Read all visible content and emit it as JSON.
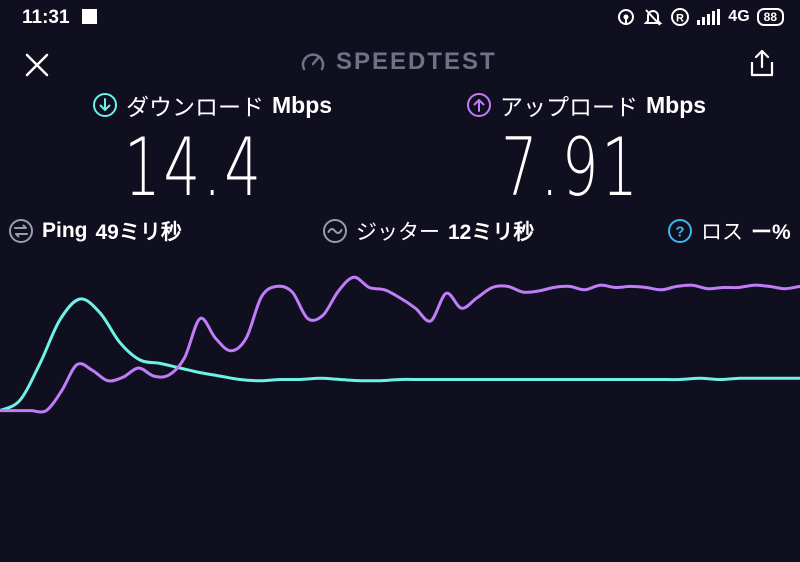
{
  "status_bar": {
    "time": "11:31",
    "network": "4G",
    "battery": "88",
    "icons": [
      "hotspot-icon",
      "notifications-muted-icon",
      "roaming-icon",
      "signal-icon"
    ]
  },
  "header": {
    "title": "SPEEDTEST",
    "close_icon": "close-icon",
    "share_icon": "share-icon"
  },
  "download": {
    "label": "ダウンロード",
    "unit": "Mbps",
    "value": "14.4",
    "color": "#6ff0e8"
  },
  "upload": {
    "label": "アップロード",
    "unit": "Mbps",
    "value": "7.91",
    "color": "#c17cf7"
  },
  "stats": {
    "ping_label": "Ping",
    "ping_value": "49ミリ秒",
    "jitter_label": "ジッター",
    "jitter_value": "12ミリ秒",
    "loss_label": "ロス",
    "loss_value": "ー%"
  },
  "chart_data": {
    "type": "line",
    "title": "",
    "xlabel": "",
    "ylabel": "",
    "series": [
      {
        "name": "",
        "color": "#6ff0e8",
        "values": [
          3,
          12,
          44,
          82,
          100,
          88,
          62,
          47,
          44,
          40,
          36,
          33,
          30,
          29,
          30,
          30,
          31,
          30,
          29,
          29,
          30,
          30,
          30,
          30,
          30,
          30,
          30,
          30,
          30,
          30,
          30,
          30,
          30,
          30,
          30,
          31,
          30,
          31,
          31,
          31,
          31
        ]
      },
      {
        "name": "",
        "color": "#c17cf7",
        "values": [
          3,
          3,
          3,
          3,
          20,
          43,
          38,
          29,
          32,
          40,
          33,
          34,
          49,
          83,
          66,
          55,
          66,
          102,
          111,
          106,
          83,
          86,
          107,
          119,
          110,
          108,
          101,
          92,
          81,
          105,
          92,
          101,
          110,
          111,
          106,
          107,
          110,
          111,
          108,
          112,
          110,
          111,
          110,
          108,
          111,
          112,
          109,
          110,
          110,
          112,
          111,
          109,
          111
        ]
      }
    ]
  }
}
